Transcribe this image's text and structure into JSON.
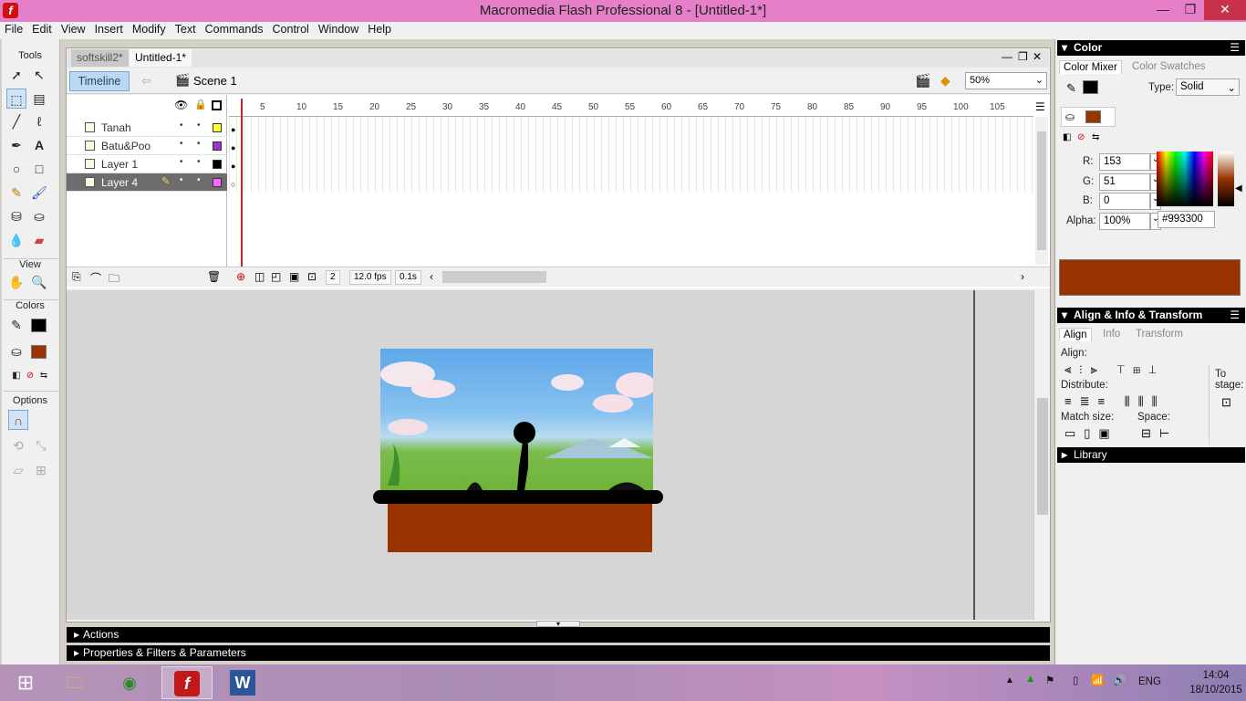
{
  "window": {
    "title": "Macromedia Flash Professional 8 - [Untitled-1*]",
    "minimize": "—",
    "restore": "❐",
    "close": "✕",
    "doc_minimize": "—",
    "doc_restore": "❐",
    "doc_close": "✕"
  },
  "menu": [
    "File",
    "Edit",
    "View",
    "Insert",
    "Modify",
    "Text",
    "Commands",
    "Control",
    "Window",
    "Help"
  ],
  "tools": {
    "header": "Tools",
    "view_header": "View",
    "colors_header": "Colors",
    "options_header": "Options"
  },
  "doc_tabs": [
    "softskill2*",
    "Untitled-1*"
  ],
  "edit_bar": {
    "timeline_label": "Timeline",
    "scene_label": "Scene 1",
    "zoom": "50%"
  },
  "timeline": {
    "ruler": [
      "5",
      "10",
      "15",
      "20",
      "25",
      "30",
      "35",
      "40",
      "45",
      "50",
      "55",
      "60",
      "65",
      "70",
      "75",
      "80",
      "85",
      "90",
      "95",
      "100",
      "105"
    ],
    "layers": [
      {
        "name": "Tanah",
        "color": "#ffff33",
        "selected": false
      },
      {
        "name": "Batu&Poo",
        "color": "#9933cc",
        "selected": false
      },
      {
        "name": "Layer 1",
        "color": "#000000",
        "selected": false
      },
      {
        "name": "Layer 4",
        "color": "#ff66ff",
        "selected": true
      }
    ],
    "current_frame": "2",
    "frame_rate": "12.0 fps",
    "elapsed": "0.1s"
  },
  "panels": {
    "actions": "Actions",
    "properties": "Properties & Filters & Parameters"
  },
  "color_panel": {
    "title": "Color",
    "tabs": [
      "Color Mixer",
      "Color Swatches"
    ],
    "type_label": "Type:",
    "type_value": "Solid",
    "r_label": "R:",
    "r": "153",
    "g_label": "G:",
    "g": "51",
    "b_label": "B:",
    "b": "0",
    "alpha_label": "Alpha:",
    "alpha": "100%",
    "hex": "#993300",
    "fill_color": "#993300"
  },
  "align_panel": {
    "title": "Align & Info & Transform",
    "tabs": [
      "Align",
      "Info",
      "Transform"
    ],
    "align_label": "Align:",
    "distribute_label": "Distribute:",
    "match_size_label": "Match size:",
    "space_label": "Space:",
    "to_stage_label": "To stage:"
  },
  "library": {
    "title": "Library"
  },
  "tray": {
    "language": "ENG",
    "time": "14:04",
    "date": "18/10/2015"
  }
}
